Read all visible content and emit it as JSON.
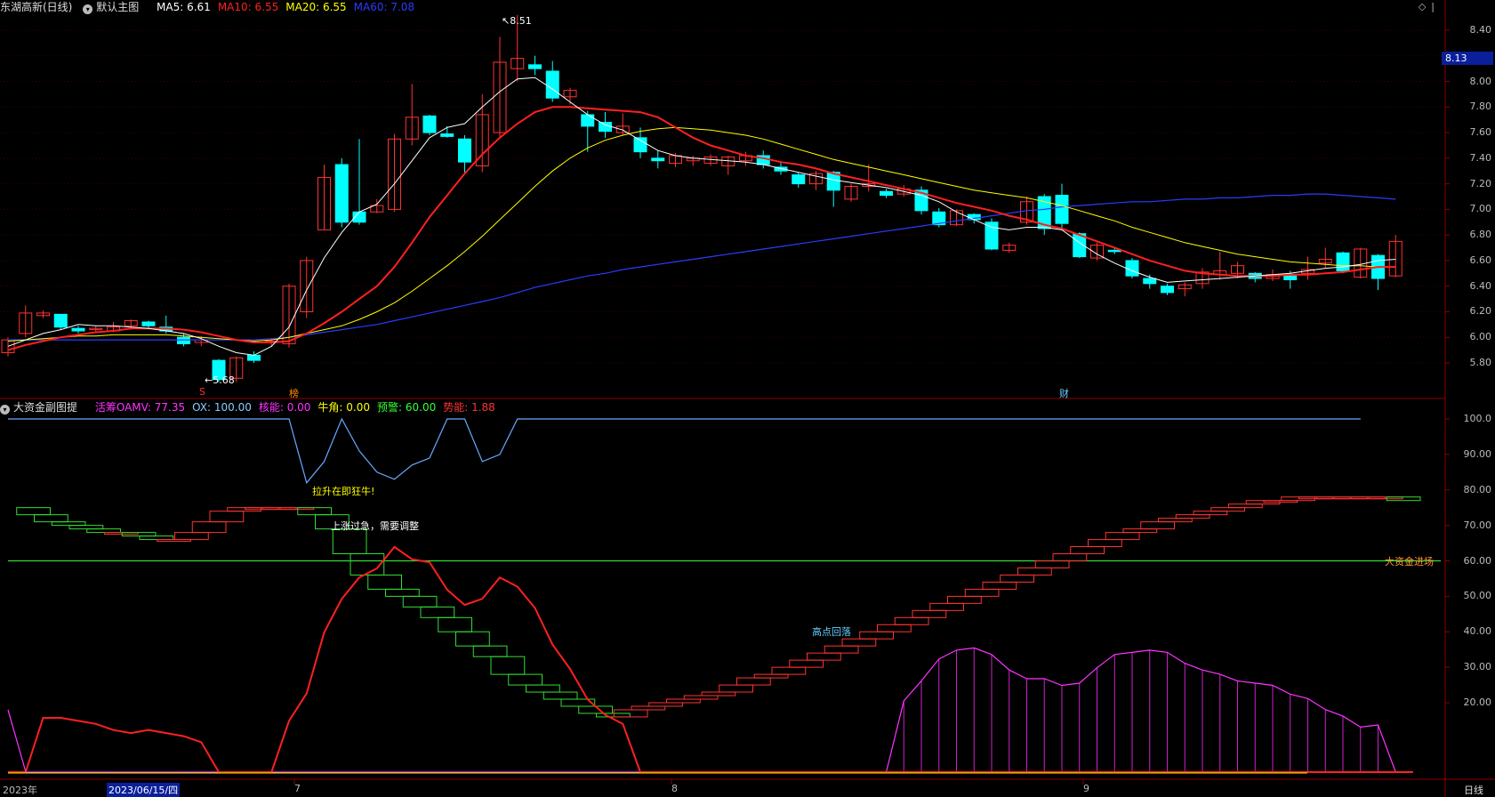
{
  "header": {
    "stock_name": "东湖高新(日线)",
    "main_chart": "默认主图",
    "ma": [
      {
        "label": "MA5: 6.61",
        "color": "#ffffff"
      },
      {
        "label": "MA10: 6.55",
        "color": "#ff2020"
      },
      {
        "label": "MA20: 6.55",
        "color": "#ffff00"
      },
      {
        "label": "MA60: 7.08",
        "color": "#2a3cff"
      }
    ]
  },
  "sub_header": {
    "title": "大资金副图提",
    "items": [
      {
        "label": "活筹OAMV: 77.35",
        "color": "#ff33ff"
      },
      {
        "label": "OX: 100.00",
        "color": "#88ccff"
      },
      {
        "label": "核能: 0.00",
        "color": "#ff33ff"
      },
      {
        "label": "牛角: 0.00",
        "color": "#ffff00"
      },
      {
        "label": "预警: 60.00",
        "color": "#33ff33"
      },
      {
        "label": "势能: 1.88",
        "color": "#ff3333"
      }
    ]
  },
  "price_axis": {
    "ticks": [
      "8.40",
      "8.20",
      "8.00",
      "7.80",
      "7.60",
      "7.40",
      "7.20",
      "7.00",
      "6.80",
      "6.60",
      "6.40",
      "6.20",
      "6.00",
      "5.80"
    ],
    "current": "8.13"
  },
  "sub_axis": {
    "ticks": [
      "100.0",
      "90.00",
      "80.00",
      "70.00",
      "60.00",
      "50.00",
      "40.00",
      "30.00",
      "20.00"
    ]
  },
  "x_axis": {
    "labels": [
      "2023年",
      "7",
      "8",
      "9"
    ],
    "selected": "2023/06/15/四",
    "period": "日线"
  },
  "annotations": {
    "high": "8.51",
    "low": "5.68",
    "lift": "拉升在即狂牛!",
    "overheat": "上涨过急，需要调整",
    "pullback": "高点回落",
    "big_money": "大资金进场"
  },
  "event_marks": [
    "S",
    "榜",
    "财"
  ],
  "chart_data": {
    "type": "candlestick",
    "ylim": [
      5.68,
      8.51
    ],
    "candles": [
      [
        5.88,
        5.98,
        5.85,
        6.0
      ],
      [
        6.03,
        6.19,
        6.0,
        6.25
      ],
      [
        6.17,
        6.19,
        6.15,
        6.21
      ],
      [
        6.18,
        6.08,
        6.06,
        6.18
      ],
      [
        6.07,
        6.05,
        6.03,
        6.09
      ],
      [
        6.06,
        6.07,
        6.04,
        6.09
      ],
      [
        6.05,
        6.08,
        6.04,
        6.12
      ],
      [
        6.09,
        6.13,
        6.06,
        6.14
      ],
      [
        6.12,
        6.09,
        6.07,
        6.13
      ],
      [
        6.08,
        6.05,
        6.03,
        6.17
      ],
      [
        6.0,
        5.95,
        5.93,
        6.03
      ],
      [
        5.96,
        5.98,
        5.93,
        6.01
      ],
      [
        5.82,
        5.67,
        5.65,
        5.83
      ],
      [
        5.68,
        5.84,
        5.65,
        5.85
      ],
      [
        5.86,
        5.82,
        5.8,
        5.89
      ],
      [
        5.96,
        5.97,
        5.93,
        5.99
      ],
      [
        5.95,
        6.4,
        5.92,
        6.42
      ],
      [
        6.2,
        6.6,
        6.15,
        6.63
      ],
      [
        6.84,
        7.25,
        6.84,
        7.35
      ],
      [
        7.35,
        6.9,
        6.86,
        7.4
      ],
      [
        6.98,
        6.9,
        6.88,
        7.55
      ],
      [
        6.98,
        7.03,
        6.97,
        7.08
      ],
      [
        7.0,
        7.55,
        6.98,
        7.59
      ],
      [
        7.55,
        7.72,
        7.5,
        7.98
      ],
      [
        7.73,
        7.6,
        7.58,
        7.74
      ],
      [
        7.59,
        7.57,
        7.56,
        7.65
      ],
      [
        7.55,
        7.37,
        7.28,
        7.58
      ],
      [
        7.34,
        7.74,
        7.29,
        7.9
      ],
      [
        7.6,
        8.15,
        7.56,
        8.35
      ],
      [
        8.1,
        8.18,
        8.0,
        8.52
      ],
      [
        8.13,
        8.1,
        8.05,
        8.2
      ],
      [
        8.08,
        7.87,
        7.84,
        8.16
      ],
      [
        7.88,
        7.93,
        7.82,
        7.95
      ],
      [
        7.74,
        7.65,
        7.45,
        7.77
      ],
      [
        7.68,
        7.61,
        7.56,
        7.76
      ],
      [
        7.6,
        7.65,
        7.58,
        7.75
      ],
      [
        7.56,
        7.45,
        7.4,
        7.64
      ],
      [
        7.4,
        7.38,
        7.32,
        7.46
      ],
      [
        7.36,
        7.42,
        7.33,
        7.44
      ],
      [
        7.38,
        7.4,
        7.34,
        7.42
      ],
      [
        7.36,
        7.41,
        7.34,
        7.43
      ],
      [
        7.34,
        7.41,
        7.27,
        7.42
      ],
      [
        7.38,
        7.42,
        7.34,
        7.45
      ],
      [
        7.42,
        7.35,
        7.32,
        7.46
      ],
      [
        7.33,
        7.3,
        7.27,
        7.37
      ],
      [
        7.27,
        7.2,
        7.17,
        7.29
      ],
      [
        7.2,
        7.28,
        7.15,
        7.3
      ],
      [
        7.29,
        7.15,
        7.02,
        7.3
      ],
      [
        7.08,
        7.18,
        7.06,
        7.2
      ],
      [
        7.18,
        7.2,
        7.14,
        7.35
      ],
      [
        7.14,
        7.11,
        7.09,
        7.16
      ],
      [
        7.12,
        7.16,
        7.1,
        7.19
      ],
      [
        7.15,
        6.99,
        6.96,
        7.18
      ],
      [
        6.98,
        6.88,
        6.86,
        7.01
      ],
      [
        6.88,
        6.99,
        6.87,
        7.0
      ],
      [
        6.96,
        6.92,
        6.89,
        6.97
      ],
      [
        6.9,
        6.69,
        6.68,
        6.93
      ],
      [
        6.68,
        6.72,
        6.66,
        6.74
      ],
      [
        6.9,
        7.06,
        6.88,
        7.1
      ],
      [
        7.1,
        6.85,
        6.8,
        7.12
      ],
      [
        7.11,
        6.89,
        6.85,
        7.2
      ],
      [
        6.81,
        6.63,
        6.62,
        6.82
      ],
      [
        6.62,
        6.72,
        6.6,
        6.74
      ],
      [
        6.68,
        6.67,
        6.65,
        6.7
      ],
      [
        6.6,
        6.48,
        6.46,
        6.62
      ],
      [
        6.46,
        6.42,
        6.38,
        6.49
      ],
      [
        6.4,
        6.35,
        6.33,
        6.42
      ],
      [
        6.38,
        6.41,
        6.32,
        6.43
      ],
      [
        6.42,
        6.51,
        6.38,
        6.54
      ],
      [
        6.49,
        6.52,
        6.45,
        6.67
      ],
      [
        6.5,
        6.56,
        6.46,
        6.59
      ],
      [
        6.5,
        6.46,
        6.43,
        6.51
      ],
      [
        6.46,
        6.49,
        6.44,
        6.53
      ],
      [
        6.48,
        6.45,
        6.38,
        6.52
      ],
      [
        6.5,
        6.53,
        6.45,
        6.63
      ],
      [
        6.58,
        6.61,
        6.54,
        6.7
      ],
      [
        6.66,
        6.52,
        6.5,
        6.67
      ],
      [
        6.47,
        6.69,
        6.46,
        6.7
      ],
      [
        6.64,
        6.46,
        6.37,
        6.65
      ],
      [
        6.48,
        6.75,
        6.47,
        6.8
      ]
    ],
    "ma5": [
      5.93,
      5.98,
      6.03,
      6.06,
      6.1,
      6.09,
      6.09,
      6.08,
      6.07,
      6.05,
      6.03,
      5.99,
      5.93,
      5.88,
      5.86,
      5.93,
      6.08,
      6.37,
      6.62,
      6.82,
      6.98,
      7.04,
      7.2,
      7.38,
      7.56,
      7.64,
      7.67,
      7.8,
      7.92,
      8.02,
      8.03,
      7.94,
      7.84,
      7.74,
      7.66,
      7.62,
      7.54,
      7.46,
      7.42,
      7.4,
      7.39,
      7.38,
      7.37,
      7.35,
      7.32,
      7.29,
      7.26,
      7.23,
      7.21,
      7.19,
      7.17,
      7.14,
      7.11,
      7.06,
      6.98,
      6.92,
      6.86,
      6.84,
      6.86,
      6.86,
      6.84,
      6.74,
      6.65,
      6.58,
      6.52,
      6.47,
      6.43,
      6.44,
      6.45,
      6.46,
      6.47,
      6.48,
      6.49,
      6.5,
      6.52,
      6.54,
      6.55,
      6.57,
      6.6,
      6.61
    ],
    "ma10": [
      5.9,
      5.94,
      5.97,
      6.0,
      6.02,
      6.04,
      6.05,
      6.07,
      6.07,
      6.07,
      6.06,
      6.04,
      6.01,
      5.98,
      5.96,
      5.96,
      5.97,
      6.03,
      6.11,
      6.2,
      6.3,
      6.4,
      6.55,
      6.74,
      6.94,
      7.11,
      7.28,
      7.43,
      7.56,
      7.67,
      7.76,
      7.8,
      7.8,
      7.79,
      7.78,
      7.77,
      7.76,
      7.72,
      7.64,
      7.56,
      7.5,
      7.46,
      7.42,
      7.4,
      7.37,
      7.35,
      7.32,
      7.28,
      7.25,
      7.22,
      7.19,
      7.16,
      7.13,
      7.09,
      7.05,
      7.02,
      6.99,
      6.95,
      6.92,
      6.88,
      6.85,
      6.8,
      6.75,
      6.7,
      6.65,
      6.6,
      6.56,
      6.52,
      6.5,
      6.49,
      6.48,
      6.48,
      6.48,
      6.49,
      6.49,
      6.5,
      6.51,
      6.53,
      6.55,
      6.55
    ],
    "ma20": [
      5.97,
      5.98,
      5.99,
      6.0,
      6.01,
      6.01,
      6.02,
      6.02,
      6.02,
      6.02,
      6.01,
      6.0,
      5.99,
      5.98,
      5.97,
      5.98,
      6.0,
      6.03,
      6.06,
      6.09,
      6.14,
      6.2,
      6.27,
      6.36,
      6.46,
      6.56,
      6.67,
      6.79,
      6.92,
      7.05,
      7.18,
      7.3,
      7.4,
      7.48,
      7.54,
      7.58,
      7.61,
      7.63,
      7.64,
      7.63,
      7.62,
      7.6,
      7.58,
      7.55,
      7.51,
      7.47,
      7.43,
      7.39,
      7.36,
      7.33,
      7.3,
      7.27,
      7.24,
      7.21,
      7.18,
      7.15,
      7.13,
      7.11,
      7.09,
      7.06,
      7.03,
      6.99,
      6.95,
      6.91,
      6.86,
      6.82,
      6.78,
      6.74,
      6.71,
      6.68,
      6.65,
      6.63,
      6.61,
      6.59,
      6.58,
      6.57,
      6.56,
      6.56,
      6.55,
      6.55
    ],
    "ma60": [
      5.98,
      5.98,
      5.98,
      5.98,
      5.98,
      5.98,
      5.98,
      5.98,
      5.98,
      5.98,
      5.98,
      5.98,
      5.98,
      5.98,
      5.98,
      5.99,
      6.0,
      6.02,
      6.04,
      6.06,
      6.08,
      6.1,
      6.13,
      6.16,
      6.19,
      6.22,
      6.25,
      6.28,
      6.31,
      6.35,
      6.39,
      6.42,
      6.45,
      6.48,
      6.5,
      6.53,
      6.55,
      6.57,
      6.59,
      6.61,
      6.63,
      6.65,
      6.67,
      6.69,
      6.71,
      6.73,
      6.75,
      6.77,
      6.79,
      6.81,
      6.83,
      6.85,
      6.87,
      6.89,
      6.91,
      6.93,
      6.95,
      6.97,
      6.99,
      7.0,
      7.02,
      7.03,
      7.04,
      7.05,
      7.06,
      7.06,
      7.07,
      7.08,
      7.08,
      7.09,
      7.09,
      7.1,
      7.11,
      7.11,
      7.12,
      7.12,
      7.11,
      7.1,
      7.09,
      7.08
    ],
    "sub_ylim": [
      0,
      100
    ],
    "ox": [
      100,
      100,
      100,
      100,
      100,
      100,
      100,
      100,
      100,
      100,
      100,
      100,
      100,
      100,
      100,
      100,
      100,
      82,
      88,
      100,
      91,
      85,
      83,
      87,
      89,
      100,
      100,
      88,
      90,
      100,
      100,
      100,
      100,
      100,
      100,
      100,
      100,
      100,
      100,
      100,
      100,
      100,
      100,
      100,
      100,
      100,
      100,
      100,
      100,
      100,
      100,
      100,
      100,
      100,
      100,
      100,
      100,
      100,
      100,
      100,
      100,
      100,
      100,
      100,
      100,
      100,
      100,
      100,
      100,
      100,
      100,
      100,
      100,
      100,
      100,
      100,
      100,
      100,
      100,
      100,
      100
    ],
    "shineng": [
      0,
      0,
      9,
      9,
      8,
      7,
      5,
      4,
      5,
      4,
      3,
      1,
      0,
      0,
      0,
      0,
      8,
      17,
      37,
      48,
      55,
      58,
      65,
      61,
      60,
      51,
      46,
      48,
      55,
      52,
      45,
      33,
      25,
      15,
      10,
      7,
      0,
      0,
      0,
      0,
      0,
      0,
      0,
      0,
      0,
      0,
      0,
      0,
      0,
      0,
      0,
      0,
      0,
      0,
      0,
      0,
      0,
      0,
      0,
      0,
      0,
      0,
      0,
      0,
      0,
      0,
      0,
      0,
      0,
      0,
      0,
      0,
      0,
      0,
      0,
      0,
      0,
      0,
      0,
      0,
      0
    ],
    "hexin": [
      0,
      0,
      0,
      0,
      0,
      0,
      0,
      0,
      0,
      0,
      0,
      0,
      0,
      0,
      0,
      0,
      0,
      0,
      0,
      0,
      0,
      0,
      0,
      0,
      0,
      0,
      0,
      0,
      0,
      0,
      0,
      0,
      0,
      0,
      0,
      0,
      0,
      0,
      0,
      0,
      0,
      0,
      0,
      0,
      0,
      0,
      0,
      0,
      0,
      0,
      0,
      13,
      22,
      32,
      36,
      37,
      34,
      27,
      23,
      23,
      20,
      21,
      28,
      34,
      35,
      36,
      35,
      30,
      27,
      25,
      22,
      21,
      20,
      16,
      14,
      9,
      6,
      1,
      2,
      0
    ],
    "oamv": [
      75,
      73,
      71,
      70,
      69,
      68,
      68,
      67,
      66,
      66,
      68,
      71,
      74,
      75,
      75,
      75,
      75,
      73,
      69,
      62,
      56,
      52,
      50,
      47,
      44,
      40,
      36,
      33,
      28,
      25,
      23,
      21,
      19,
      17,
      16,
      18,
      19,
      20,
      21,
      22,
      23,
      25,
      27,
      28,
      30,
      32,
      34,
      36,
      38,
      40,
      42,
      44,
      46,
      48,
      50,
      52,
      54,
      56,
      58,
      60,
      62,
      64,
      66,
      68,
      69,
      71,
      72,
      73,
      74,
      75,
      76,
      77,
      77,
      78,
      78,
      78,
      78,
      78,
      78,
      77,
      77
    ],
    "warning": 60,
    "hilight": 80
  }
}
